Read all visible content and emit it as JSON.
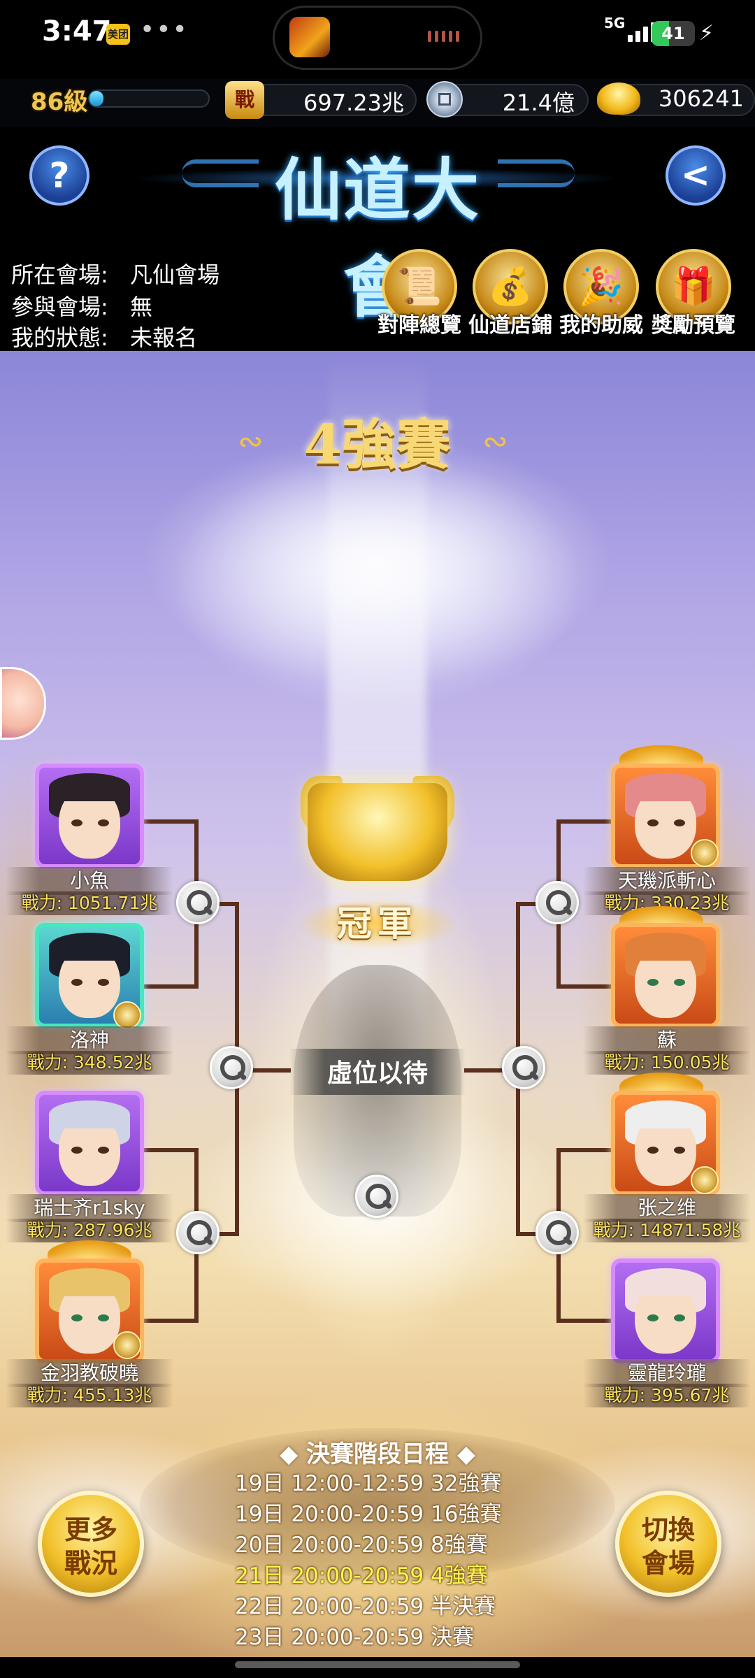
{
  "status_bar": {
    "time": "3:47",
    "app_badge": "美团",
    "more": "•••",
    "network": "5G",
    "battery": "41",
    "battery_level": 0.41
  },
  "resources": {
    "level_label": "86級",
    "xp_progress": 0.08,
    "power_icon": "戰",
    "power": "697.23兆",
    "coins": "21.4億",
    "gold": "306241"
  },
  "header": {
    "title": "仙道大會",
    "help": "?",
    "back": "<"
  },
  "info": {
    "venue_label": "所在會場:",
    "venue_value": "凡仙會場",
    "join_label": "參與會場:",
    "join_value": "無",
    "state_label": "我的狀態:",
    "state_value": "未報名"
  },
  "features": [
    {
      "label": "對陣總覽",
      "icon": "scroll-icon"
    },
    {
      "label": "仙道店鋪",
      "icon": "treasure-chest-icon"
    },
    {
      "label": "我的助威",
      "icon": "cheer-icon"
    },
    {
      "label": "獎勵預覽",
      "icon": "reward-chest-icon"
    }
  ],
  "arena": {
    "round_title": "4強賽",
    "champion_label": "冠軍",
    "pending_text": "虛位以待"
  },
  "players_left": [
    {
      "name": "小魚",
      "power": "戰力: 1051.71兆",
      "frame": "purple"
    },
    {
      "name": "洛神",
      "power": "戰力: 348.52兆",
      "frame": "teal"
    },
    {
      "name": "瑞士齐r1sky",
      "power": "戰力: 287.96兆",
      "frame": "purple"
    },
    {
      "name": "金羽教破曉",
      "power": "戰力: 455.13兆",
      "frame": "orange"
    }
  ],
  "players_right": [
    {
      "name": "天璣派斬心",
      "power": "戰力: 330.23兆",
      "frame": "orange"
    },
    {
      "name": "蘇",
      "power": "戰力: 150.05兆",
      "frame": "orange"
    },
    {
      "name": "张之维",
      "power": "戰力: 14871.58兆",
      "frame": "orange"
    },
    {
      "name": "靈龍玲瓏",
      "power": "戰力: 395.67兆",
      "frame": "purple"
    }
  ],
  "schedule": {
    "title": "決賽階段日程",
    "rows": [
      "19日 12:00-12:59 32強賽",
      "19日 20:00-20:59 16強賽",
      "20日 20:00-20:59 8強賽",
      "21日 20:00-20:59 4強賽",
      "22日 20:00-20:59 半決賽",
      "23日 20:00-20:59 決賽"
    ],
    "active_index": 3
  },
  "buttons": {
    "more_battles": "更多\n戰況",
    "switch_venue": "切換\n會場"
  },
  "colors": {
    "accent_gold": "#f2c12a",
    "bracket_line": "#5a2f1d",
    "power_text": "#ffe15a",
    "active_schedule": "#fff64a"
  }
}
